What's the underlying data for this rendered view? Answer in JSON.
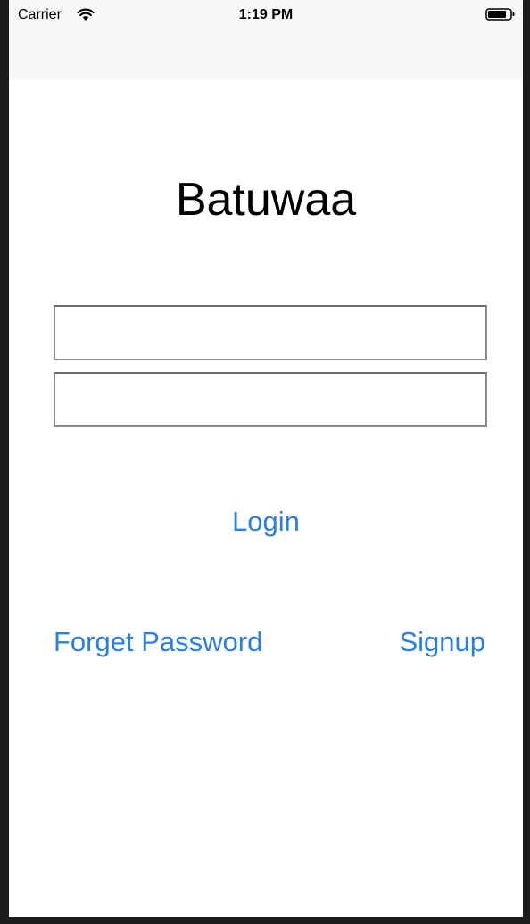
{
  "status_bar": {
    "carrier": "Carrier",
    "time": "1:19 PM",
    "wifi_icon": "wifi-icon",
    "battery_icon": "battery-icon"
  },
  "login_screen": {
    "app_title": "Batuwaa",
    "username_value": "",
    "password_value": "",
    "login_label": "Login",
    "forget_password_label": "Forget Password",
    "signup_label": "Signup"
  },
  "colors": {
    "link": "#2b7fe0",
    "field_border": "#8a8a8a",
    "status_bar_bg": "#f7f7f7"
  }
}
